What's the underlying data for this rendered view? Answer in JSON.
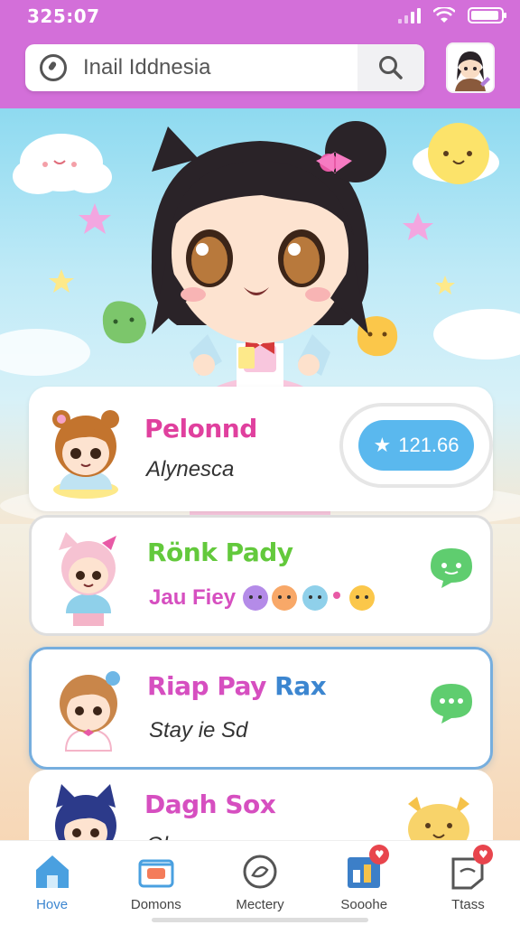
{
  "status_bar": {
    "time": "325:07"
  },
  "search": {
    "query": "Inail Iddnesia"
  },
  "hero": {
    "character": "main-anime-girl"
  },
  "contacts": [
    {
      "name": "Pelonnd",
      "subtitle": "Alynesca",
      "badge_value": "121.66",
      "name_color": "#e0409e"
    },
    {
      "name": "Rönk Pady",
      "subtitle": "Jau Fiey",
      "name_color": "#63c93c"
    },
    {
      "name": "Riap Pay",
      "name_b": "Rax",
      "subtitle": "Stay ie Sd",
      "name_color": "#d64fc0"
    },
    {
      "name": "Dagh Sox",
      "subtitle": "Ohr...",
      "name_color": "#d64fc0"
    }
  ],
  "nav": [
    {
      "label": "Hove",
      "icon": "home-icon",
      "active": true
    },
    {
      "label": "Domons",
      "icon": "box-icon"
    },
    {
      "label": "Mectery",
      "icon": "compass-icon"
    },
    {
      "label": "Sooohe",
      "icon": "chart-icon",
      "badge": "♥"
    },
    {
      "label": "Ttass",
      "icon": "tag-icon",
      "badge": "♥"
    }
  ],
  "colors": {
    "header": "#d36fd9",
    "accent": "#5ab8ee",
    "chat_green": "#5fcd6f",
    "active_nav": "#3c86d0"
  }
}
